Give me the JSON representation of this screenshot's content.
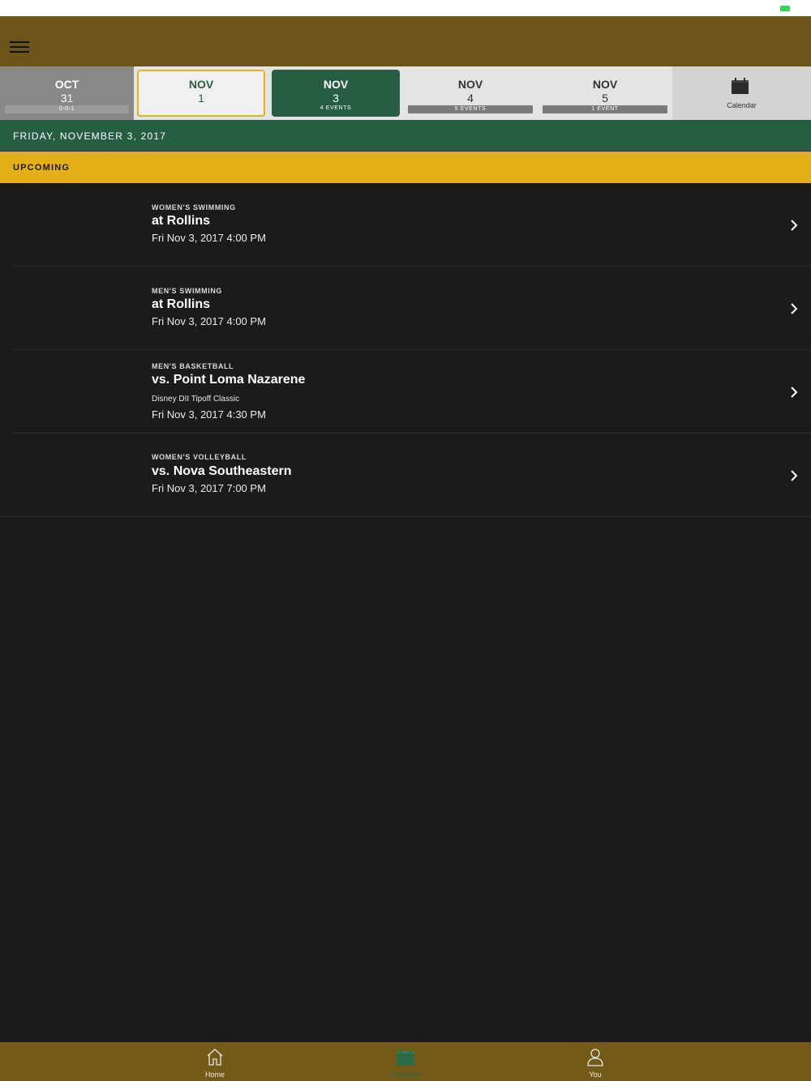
{
  "status_bar": {
    "battery_color": "#3ad35b"
  },
  "header": {
    "menu_icon": "hamburger-menu-icon",
    "background": "#6b5519"
  },
  "date_strip": {
    "cells": [
      {
        "month": "OCT",
        "day": "31",
        "badge": "0-0-1"
      },
      {
        "month": "NOV",
        "day": "1",
        "badge": ""
      },
      {
        "month": "NOV",
        "day": "3",
        "badge": "4 EVENTS"
      },
      {
        "month": "NOV",
        "day": "4",
        "badge": "5 EVENTS"
      },
      {
        "month": "NOV",
        "day": "5",
        "badge": "1 EVENT"
      }
    ],
    "calendar": {
      "label": "Calendar",
      "icon": "calendar-icon"
    },
    "selected_color": "#265d43",
    "today_border_color": "#e6b113"
  },
  "day_header": "FRIDAY, NOVEMBER 3, 2017",
  "section_label": "UPCOMING",
  "events": [
    {
      "sport": "WOMEN'S SWIMMING",
      "opponent": "at Rollins",
      "note": "",
      "time": "Fri Nov 3, 2017 4:00 PM"
    },
    {
      "sport": "MEN'S SWIMMING",
      "opponent": "at Rollins",
      "note": "",
      "time": "Fri Nov 3, 2017 4:00 PM"
    },
    {
      "sport": "MEN'S BASKETBALL",
      "opponent": "vs. Point Loma Nazarene",
      "note": "Disney DII Tipoff Classic",
      "time": "Fri Nov 3, 2017 4:30 PM"
    },
    {
      "sport": "WOMEN'S VOLLEYBALL",
      "opponent": "vs. Nova Southeastern",
      "note": "",
      "time": "Fri Nov 3, 2017 7:00 PM"
    }
  ],
  "tabs": [
    {
      "label": "Home",
      "icon": "home-icon"
    },
    {
      "label": "Schedule",
      "icon": "schedule-calendar-icon",
      "active": true
    },
    {
      "label": "You",
      "icon": "person-icon"
    }
  ],
  "colors": {
    "accent_gold": "#e5b017",
    "brand_green": "#265d43",
    "bar_brown": "#735a18"
  }
}
